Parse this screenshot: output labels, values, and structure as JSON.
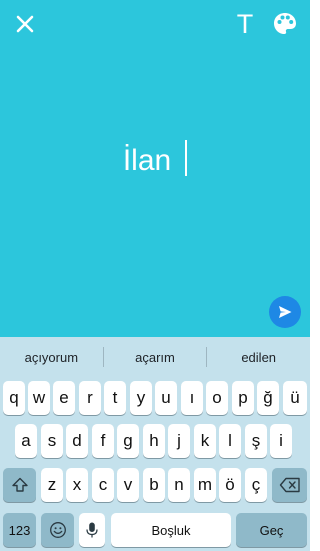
{
  "composer": {
    "text": "İlan",
    "colors": {
      "background": "#2cc6dc",
      "send_button": "#1e88e5"
    }
  },
  "toolbar": {
    "icons": [
      "close-icon",
      "text-style-icon",
      "color-palette-icon"
    ],
    "text_tool_label": "T"
  },
  "keyboard": {
    "suggestions": [
      "açıyorum",
      "açarım",
      "edilen"
    ],
    "row1": [
      "q",
      "w",
      "e",
      "r",
      "t",
      "y",
      "u",
      "ı",
      "o",
      "p",
      "ğ",
      "ü"
    ],
    "row2": [
      "a",
      "s",
      "d",
      "f",
      "g",
      "h",
      "j",
      "k",
      "l",
      "ş",
      "i"
    ],
    "row3": [
      "z",
      "x",
      "c",
      "v",
      "b",
      "n",
      "m",
      "ö",
      "ç"
    ],
    "numbers_label": "123",
    "space_label": "Boşluk",
    "return_label": "Geç",
    "icons": [
      "shift-icon",
      "backspace-icon",
      "emoji-icon",
      "microphone-icon"
    ]
  }
}
